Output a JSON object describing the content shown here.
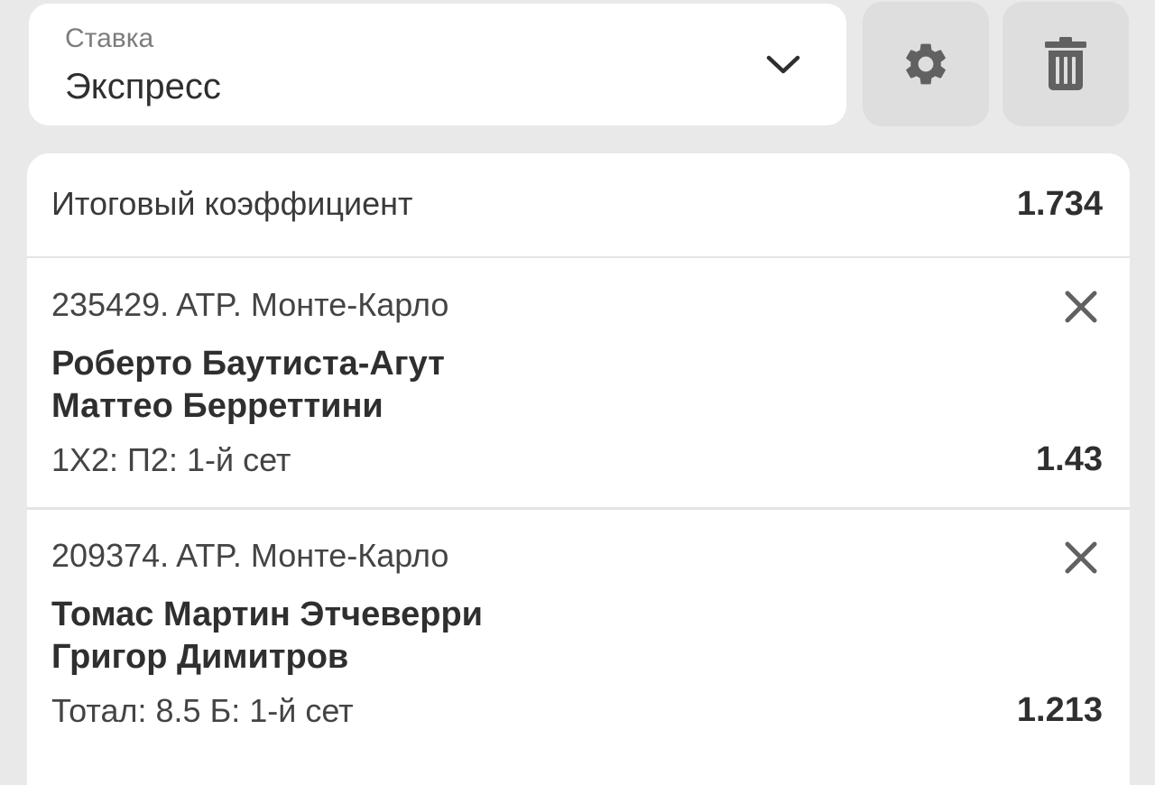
{
  "bet_type": {
    "caption": "Ставка",
    "value": "Экспресс"
  },
  "toolbar": {
    "settings_icon": "gear-icon",
    "delete_icon": "trash-icon"
  },
  "total": {
    "label": "Итоговый коэффициент",
    "value": "1.734"
  },
  "events": [
    {
      "header": "235429. ATP. Монте-Карло",
      "team1": "Роберто Баутиста-Агут",
      "team2": "Маттео Берреттини",
      "market": "1X2: П2: 1-й сет",
      "odd": "1.43"
    },
    {
      "header": "209374. ATP. Монте-Карло",
      "team1": "Томас Мартин Этчеверри",
      "team2": "Григор Димитров",
      "market": "Тотал: 8.5 Б: 1-й сет",
      "odd": "1.213"
    }
  ],
  "colors": {
    "background": "#e9e9e9",
    "card": "#ffffff",
    "icon": "#616161",
    "button": "#dedede"
  }
}
